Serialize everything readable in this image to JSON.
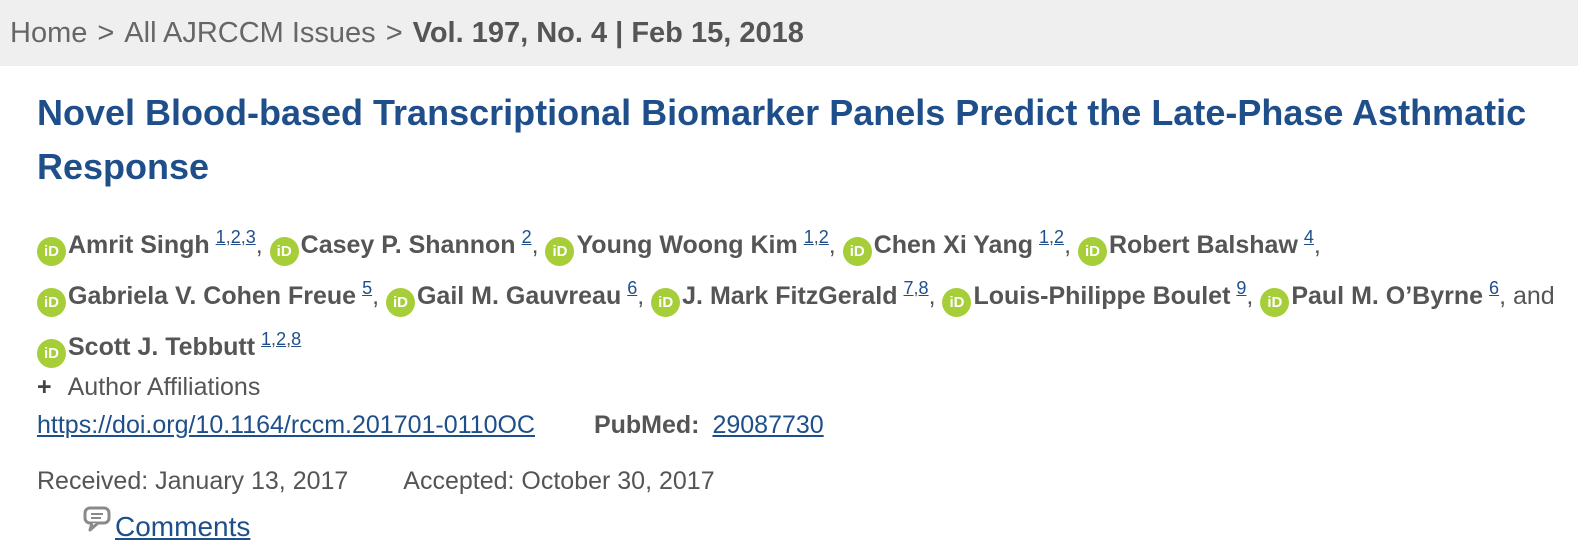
{
  "breadcrumb": {
    "home": "Home",
    "separator": ">",
    "issues": "All AJRCCM Issues",
    "current": "Vol. 197, No. 4 | Feb 15, 2018"
  },
  "article": {
    "title": "Novel Blood-based Transcriptional Biomarker Panels Predict the Late-Phase Asthmatic Response"
  },
  "authors": [
    {
      "name": "Amrit Singh",
      "affiliations": [
        "1",
        "2",
        "3"
      ]
    },
    {
      "name": "Casey P. Shannon",
      "affiliations": [
        "2"
      ]
    },
    {
      "name": "Young Woong Kim",
      "affiliations": [
        "1",
        "2"
      ]
    },
    {
      "name": "Chen Xi Yang",
      "affiliations": [
        "1",
        "2"
      ]
    },
    {
      "name": "Robert Balshaw",
      "affiliations": [
        "4"
      ]
    },
    {
      "name": "Gabriela V. Cohen Freue",
      "affiliations": [
        "5"
      ]
    },
    {
      "name": "Gail M. Gauvreau",
      "affiliations": [
        "6"
      ]
    },
    {
      "name": "J. Mark FitzGerald",
      "affiliations": [
        "7",
        "8"
      ]
    },
    {
      "name": "Louis-Philippe Boulet",
      "affiliations": [
        "9"
      ]
    },
    {
      "name": "Paul M. O’Byrne",
      "affiliations": [
        "6"
      ]
    },
    {
      "name": "Scott J. Tebbutt",
      "affiliations": [
        "1",
        "2",
        "8"
      ]
    }
  ],
  "author_list": {
    "and_text": "and",
    "orcid_badge": "iD",
    "orcid_color": "#a6ce39"
  },
  "affiliations_toggle": {
    "icon": "+",
    "label": "Author Affiliations"
  },
  "identifiers": {
    "doi": "https://doi.org/10.1164/rccm.201701-0110OC",
    "pubmed_label": "PubMed:",
    "pubmed_id": "29087730"
  },
  "dates": {
    "received": "Received: January 13, 2017",
    "accepted": "Accepted: October 30, 2017"
  },
  "comments": {
    "icon": "comment-bubble-icon",
    "label": "Comments"
  },
  "colors": {
    "link": "#1f4f8a",
    "text": "#555555",
    "breadcrumb_bg": "#efefef"
  }
}
